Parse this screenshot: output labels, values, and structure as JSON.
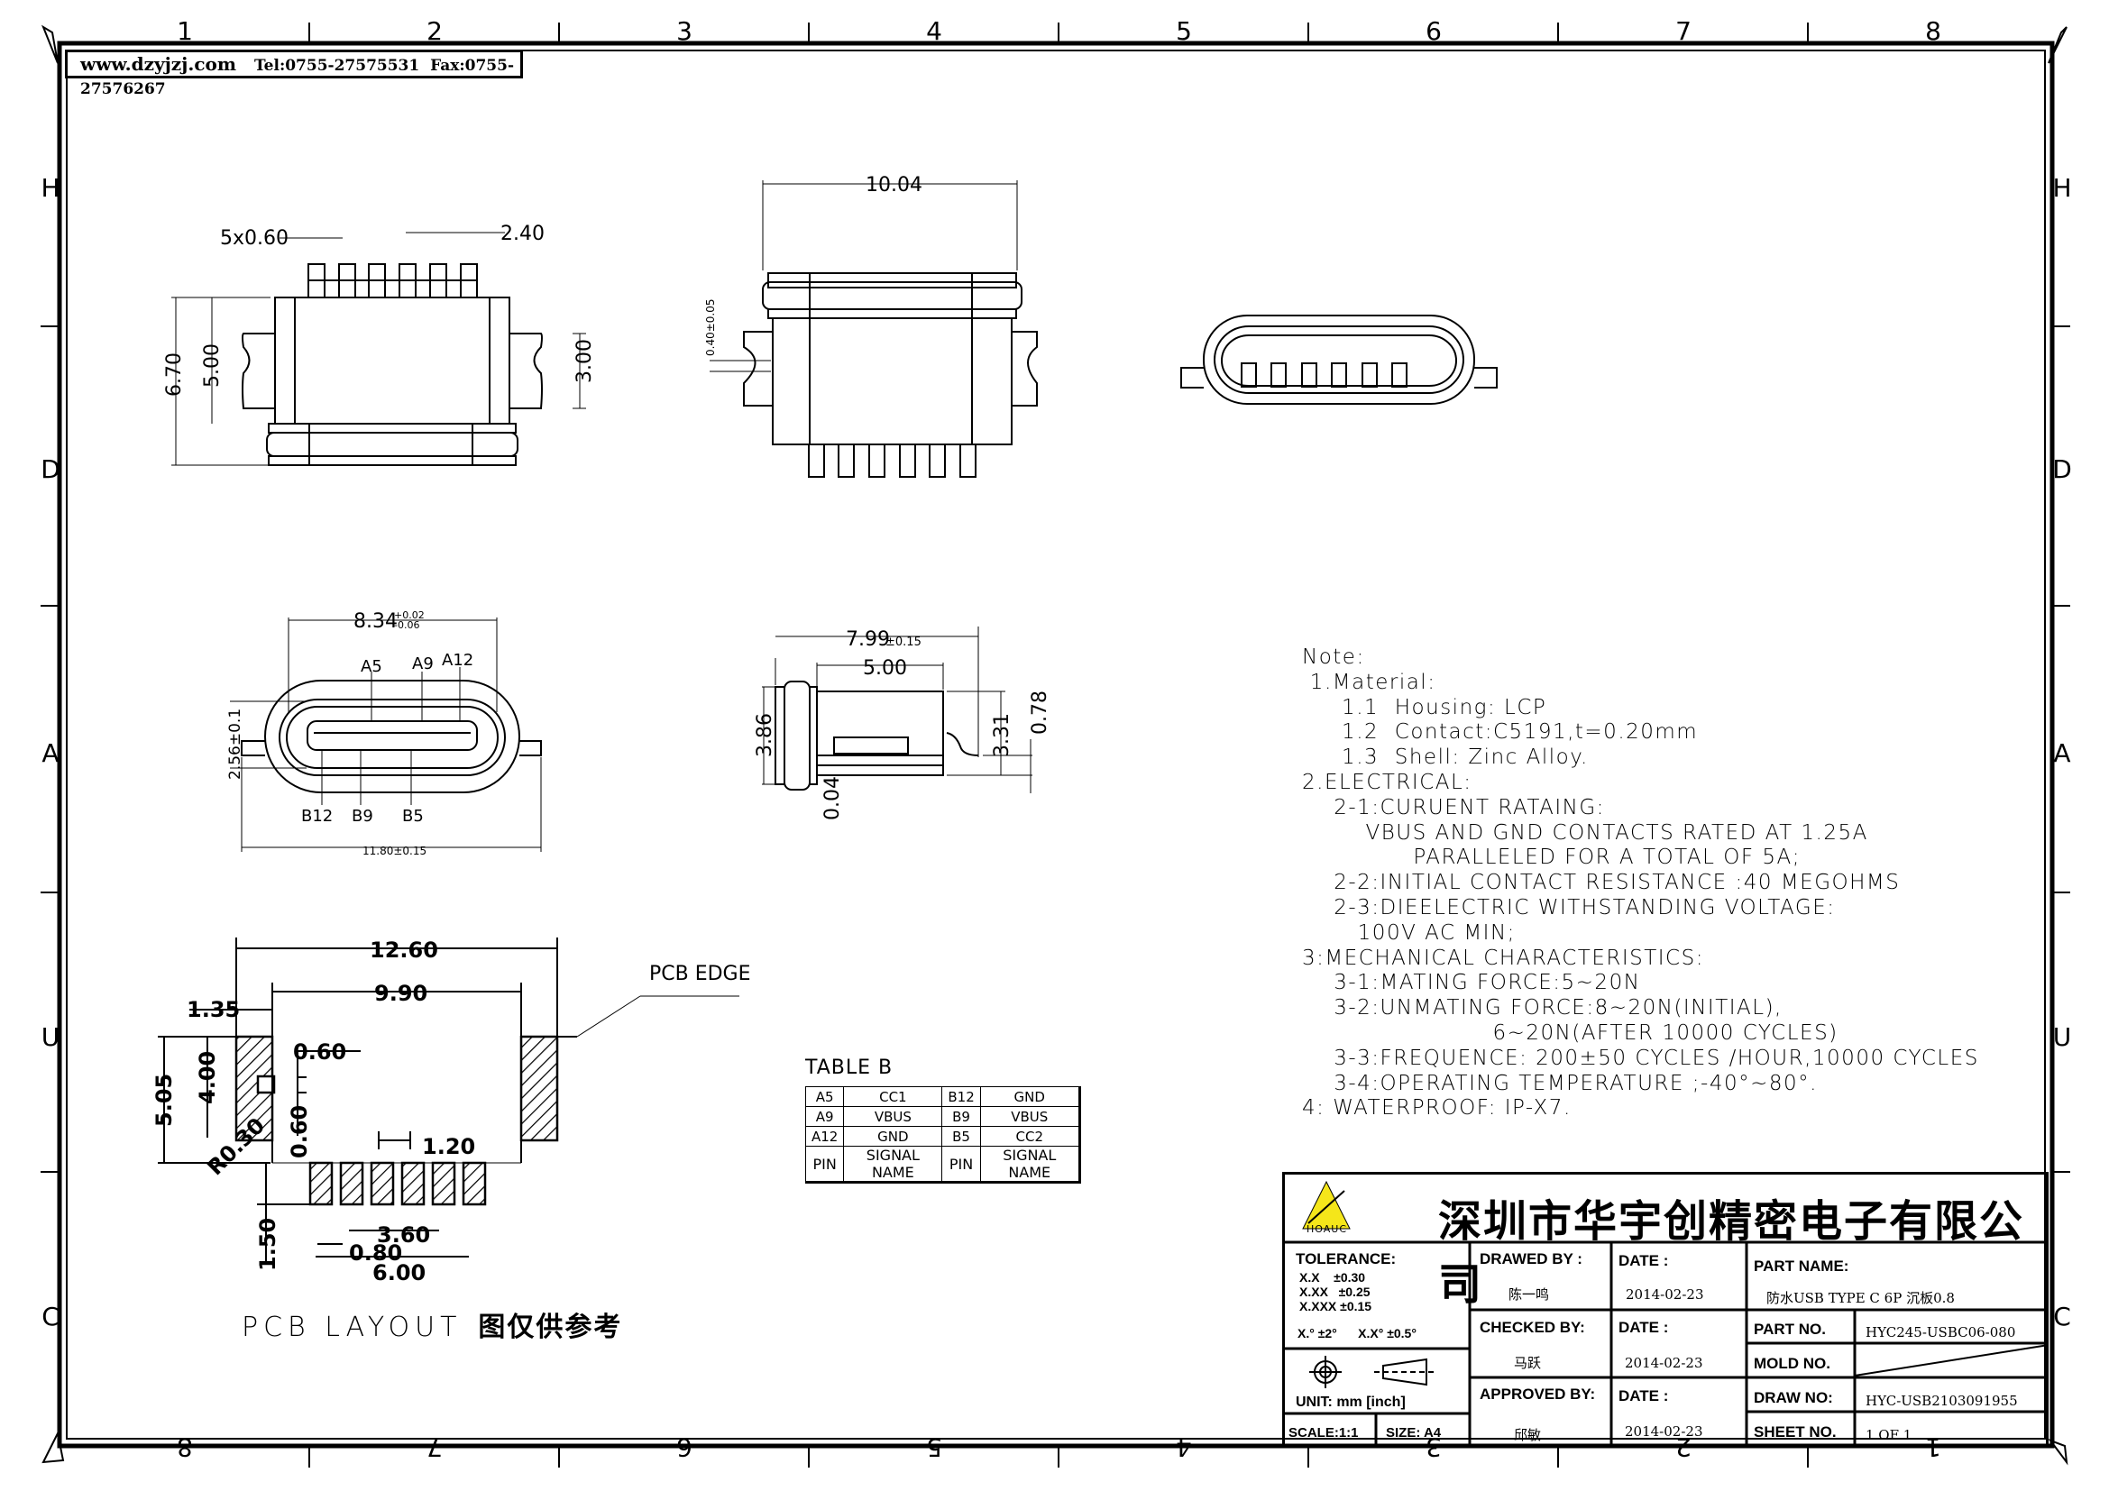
{
  "header": {
    "website": "www.dzyjzj.com",
    "tel": "Tel:0755-27575531",
    "fax": "Fax:0755-27576267"
  },
  "zones": {
    "columns_top": [
      "1",
      "2",
      "3",
      "4",
      "5",
      "6",
      "7",
      "8"
    ],
    "columns_bottom": [
      "8",
      "7",
      "6",
      "5",
      "4",
      "3",
      "2",
      "1"
    ],
    "rows": [
      "H",
      "D",
      "A",
      "U",
      "C"
    ]
  },
  "views": {
    "top_view": {
      "pin_width": "5x0.60",
      "pitch": "2.40",
      "overall_height": "6.70",
      "body_height": "5.00",
      "tab_height": "3.00"
    },
    "rear_view": {
      "width": "10.04",
      "slot": "0.40±0.05"
    },
    "front_view": {
      "pins_note": "6 contacts"
    },
    "mating_face": {
      "width": "8.34",
      "tol_plus": "+0.02",
      "tol_minus": "-0.06",
      "height": "2.56±0.1",
      "overall_width": "11.80±0.15",
      "pins_top": [
        "A5",
        "A9",
        "A12"
      ],
      "pins_bottom": [
        "B12",
        "B9",
        "B5"
      ]
    },
    "side_view": {
      "length": "7.99",
      "length_tol": "±0.15",
      "body_length": "5.00",
      "height": "3.86",
      "sink_height": "3.31",
      "pin_offset": "0.78",
      "gap": "0.04"
    },
    "pcb_layout": {
      "overall_width": "12.60",
      "inner_width": "9.90",
      "edge_offset": "1.35",
      "slot_width_h": "0.60",
      "slot_width_v": "0.60",
      "pad_height": "4.00",
      "total_height": "5.05",
      "radius": "R0.30",
      "pitch": "1.20",
      "pin_span": "3.60",
      "pad_width": "0.80",
      "pad_span": "6.00",
      "pad_length": "1.50",
      "edge_label": "PCB EDGE"
    }
  },
  "caption": {
    "en": "PCB LAYOUT",
    "cn": "图仅供参考"
  },
  "table_b": {
    "title": "TABLE B",
    "rows": [
      [
        "A5",
        "CC1",
        "B12",
        "GND"
      ],
      [
        "A9",
        "VBUS",
        "B9",
        "VBUS"
      ],
      [
        "A12",
        "GND",
        "B5",
        "CC2"
      ]
    ],
    "header": [
      "PIN",
      "SIGNAL NAME",
      "PIN",
      "SIGNAL NAME"
    ]
  },
  "notes": [
    "Note:",
    " 1.Material:",
    "     1.1  Housing: LCP",
    "     1.2  Contact:C5191,t=0.20mm",
    "     1.3  Shell: Zinc Alloy.",
    "2.ELECTRICAL:",
    "    2-1:CURUENT RATAING:",
    "        VBUS AND GND CONTACTS RATED AT 1.25A",
    "              PARALLELED FOR A TOTAL OF 5A;",
    "    2-2:INITIAL CONTACT RESISTANCE :40 MEGOHMS",
    "    2-3:DIEELECTRIC WITHSTANDING VOLTAGE:",
    "       100V AC MIN;",
    "3:MECHANICAL CHARACTERISTICS:",
    "    3-1:MATING FORCE:5~20N",
    "    3-2:UNMATING FORCE:8~20N(INITIAL),",
    "                        6~20N(AFTER 10000 CYCLES)",
    "    3-3:FREQUENCE: 200±50 CYCLES /HOUR,10000 CYCLES",
    "    3-4:OPERATING TEMPERATURE ;-40°~80°.",
    "4: WATERPROOF: IP-X7."
  ],
  "title_block": {
    "company": "深圳市华宇创精密电子有限公司",
    "logo_text": "HOAUC",
    "tolerance_label": "TOLERANCE:",
    "tolerances": [
      [
        "X.X",
        "±0.30"
      ],
      [
        "X.XX",
        "±0.25"
      ],
      [
        "X.XXX",
        "±0.15"
      ]
    ],
    "angle_tol": [
      "X.° ±2°",
      "X.X° ±0.5°"
    ],
    "unit": "UNIT:  mm  [inch]",
    "scale": "SCALE:1:1",
    "size": "SIZE:  A4",
    "drawed_by_label": "DRAWED BY :",
    "drawed_by": "陈一鸣",
    "checked_by_label": "CHECKED BY:",
    "checked_by": "马跃",
    "approved_by_label": "APPROVED BY:",
    "approved_by": "邱敏",
    "date_label": "DATE :",
    "dates": [
      "2014-02-23",
      "2014-02-23",
      "2014-02-23"
    ],
    "part_name_label": "PART NAME:",
    "part_name": "防水USB TYPE C 6P 沉板0.8",
    "part_no_label": "PART NO.",
    "part_no": "HYC245-USBC06-080",
    "mold_no_label": "MOLD NO.",
    "mold_no": "",
    "draw_no_label": "DRAW NO:",
    "draw_no": "HYC-USB2103091955",
    "sheet_no_label": "SHEET NO.",
    "sheet_no": "1 OF 1"
  }
}
